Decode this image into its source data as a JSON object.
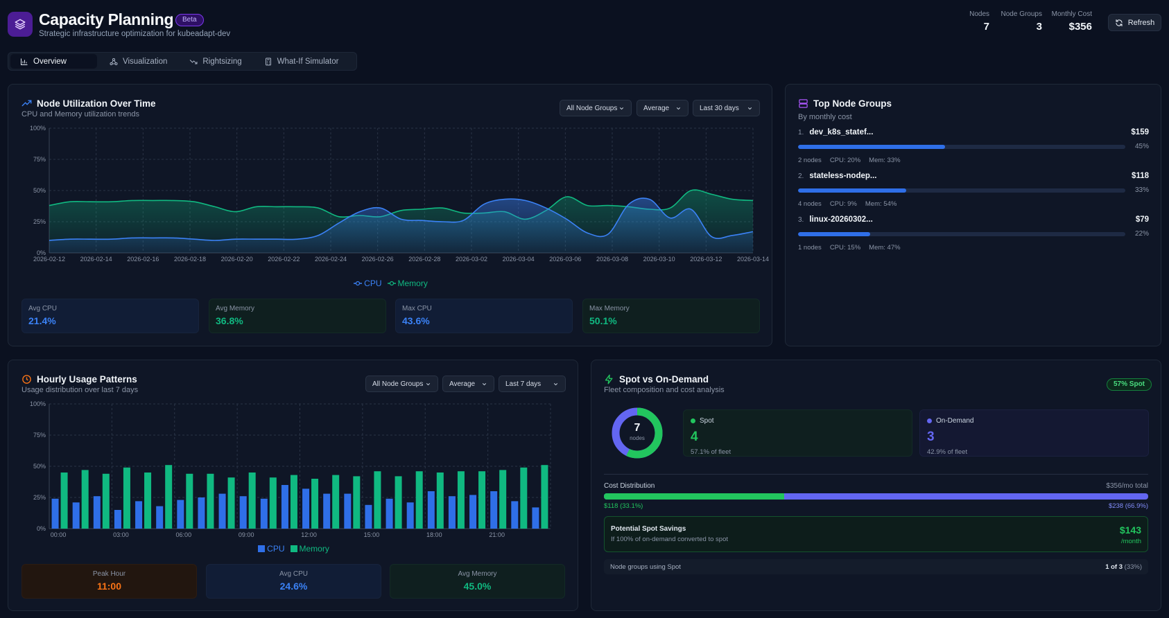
{
  "header": {
    "title": "Capacity Planning",
    "badge": "Beta",
    "subtitle": "Strategic infrastructure optimization for kubeadapt-dev",
    "stats": [
      {
        "label": "Nodes",
        "value": "7"
      },
      {
        "label": "Node Groups",
        "value": "3"
      },
      {
        "label": "Monthly Cost",
        "value": "$356"
      }
    ],
    "refresh_label": "Refresh"
  },
  "tabs": [
    {
      "label": "Overview",
      "icon": "bar-chart-icon",
      "active": true
    },
    {
      "label": "Visualization",
      "icon": "network-icon",
      "active": false
    },
    {
      "label": "Rightsizing",
      "icon": "trend-down-icon",
      "active": false
    },
    {
      "label": "What-If Simulator",
      "icon": "calculator-icon",
      "active": false
    }
  ],
  "utilization": {
    "title": "Node Utilization Over Time",
    "subtitle": "CPU and Memory utilization trends",
    "filters": {
      "groups": "All Node Groups",
      "agg": "Average",
      "range": "Last 30 days"
    },
    "legend": {
      "cpu": "CPU",
      "memory": "Memory"
    },
    "kpis": [
      {
        "label": "Avg CPU",
        "value": "21.4%"
      },
      {
        "label": "Avg Memory",
        "value": "36.8%"
      },
      {
        "label": "Max CPU",
        "value": "43.6%"
      },
      {
        "label": "Max Memory",
        "value": "50.1%"
      }
    ]
  },
  "top_groups": {
    "title": "Top Node Groups",
    "subtitle": "By monthly cost",
    "items": [
      {
        "index": "1.",
        "name": "dev_k8s_statef...",
        "cost": "$159",
        "share": 45,
        "pct": "45%",
        "nodes": "2 nodes",
        "cpu": "CPU: 20%",
        "mem": "Mem: 33%"
      },
      {
        "index": "2.",
        "name": "stateless-nodep...",
        "cost": "$118",
        "share": 33,
        "pct": "33%",
        "nodes": "4 nodes",
        "cpu": "CPU: 9%",
        "mem": "Mem: 54%"
      },
      {
        "index": "3.",
        "name": "linux-20260302...",
        "cost": "$79",
        "share": 22,
        "pct": "22%",
        "nodes": "1 nodes",
        "cpu": "CPU: 15%",
        "mem": "Mem: 47%"
      }
    ]
  },
  "hourly": {
    "title": "Hourly Usage Patterns",
    "subtitle": "Usage distribution over last 7 days",
    "filters": {
      "groups": "All Node Groups",
      "agg": "Average",
      "range": "Last 7 days"
    },
    "legend": {
      "cpu": "CPU",
      "memory": "Memory"
    },
    "kpis": [
      {
        "label": "Peak Hour",
        "value": "11:00"
      },
      {
        "label": "Avg CPU",
        "value": "24.6%"
      },
      {
        "label": "Avg Memory",
        "value": "45.0%"
      }
    ]
  },
  "spot": {
    "title": "Spot vs On-Demand",
    "subtitle": "Fleet composition and cost analysis",
    "badge": "57% Spot",
    "donut": {
      "total": "7",
      "unit": "nodes",
      "spot_fraction": 0.571
    },
    "spot_box": {
      "label": "Spot",
      "value": "4",
      "sub": "57.1% of fleet"
    },
    "ondemand_box": {
      "label": "On-Demand",
      "value": "3",
      "sub": "42.9% of fleet"
    },
    "cost": {
      "label": "Cost Distribution",
      "total": "$356/mo total",
      "spot_share": 33.1,
      "spot_label": "$118 (33.1%)",
      "ondemand_label": "$238 (66.9%)"
    },
    "savings": {
      "title": "Potential Spot Savings",
      "sub": "If 100% of on-demand converted to spot",
      "value": "$143",
      "unit": "/month"
    },
    "using": {
      "label": "Node groups using Spot",
      "value": "1 of 3",
      "pct": "(33%)"
    }
  },
  "colors": {
    "cpu": "#3b82f6",
    "memory": "#10b981",
    "spot": "#22c55e",
    "ondemand": "#6366f1",
    "peak": "#f97316"
  },
  "chart_data": [
    {
      "type": "area",
      "title": "Node Utilization Over Time",
      "x_labels": [
        "2026-02-12",
        "2026-02-14",
        "2026-02-16",
        "2026-02-18",
        "2026-02-20",
        "2026-02-22",
        "2026-02-24",
        "2026-02-26",
        "2026-02-28",
        "2026-03-02",
        "2026-03-04",
        "2026-03-06",
        "2026-03-08",
        "2026-03-10",
        "2026-03-12",
        "2026-03-14"
      ],
      "y_ticks": [
        "0%",
        "25%",
        "50%",
        "75%",
        "100%"
      ],
      "ylim": [
        0,
        100
      ],
      "series": [
        {
          "name": "CPU",
          "values": [
            10,
            11,
            11,
            11,
            12,
            12,
            12,
            11,
            10,
            11,
            11,
            11,
            11,
            14,
            24,
            33,
            36,
            27,
            26,
            25,
            26,
            39,
            43,
            42,
            36,
            27,
            16,
            15,
            39,
            43,
            28,
            35,
            13,
            14,
            17
          ]
        },
        {
          "name": "Memory",
          "values": [
            38,
            41,
            41,
            41,
            42,
            42,
            42,
            41,
            37,
            33,
            37,
            37,
            37,
            36,
            29,
            30,
            29,
            34,
            35,
            36,
            32,
            32,
            33,
            27,
            34,
            45,
            38,
            38,
            37,
            35,
            36,
            50,
            47,
            43,
            42
          ]
        }
      ]
    },
    {
      "type": "bar",
      "title": "Hourly Usage Patterns",
      "categories": [
        "00:00",
        "01:00",
        "02:00",
        "03:00",
        "04:00",
        "05:00",
        "06:00",
        "07:00",
        "08:00",
        "09:00",
        "10:00",
        "11:00",
        "12:00",
        "13:00",
        "14:00",
        "15:00",
        "16:00",
        "17:00",
        "18:00",
        "19:00",
        "20:00",
        "21:00",
        "22:00",
        "23:00"
      ],
      "tick_labels": [
        "00:00",
        "03:00",
        "06:00",
        "09:00",
        "12:00",
        "15:00",
        "18:00",
        "21:00"
      ],
      "y_ticks": [
        "0%",
        "25%",
        "50%",
        "75%",
        "100%"
      ],
      "ylim": [
        0,
        100
      ],
      "series": [
        {
          "name": "CPU",
          "values": [
            24,
            21,
            26,
            15,
            22,
            18,
            23,
            25,
            28,
            26,
            24,
            35,
            32,
            28,
            28,
            19,
            24,
            21,
            30,
            26,
            27,
            30,
            22,
            17
          ]
        },
        {
          "name": "Memory",
          "values": [
            45,
            47,
            44,
            49,
            45,
            51,
            44,
            44,
            41,
            45,
            41,
            43,
            40,
            43,
            42,
            46,
            42,
            46,
            45,
            46,
            46,
            47,
            49,
            51
          ]
        }
      ]
    }
  ]
}
